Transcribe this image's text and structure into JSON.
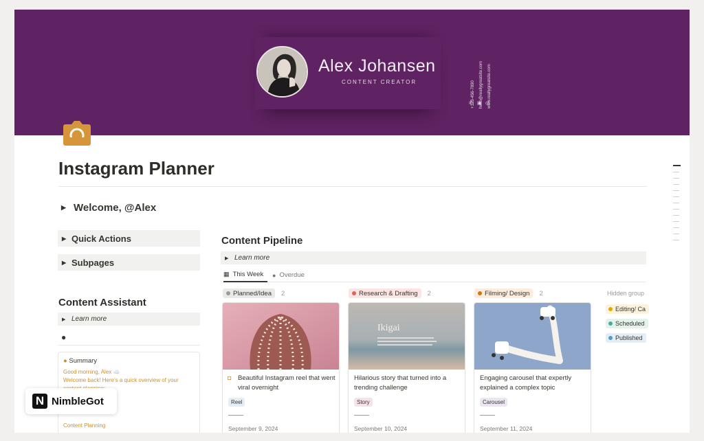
{
  "cover": {
    "name": "Alex Johansen",
    "role": "CONTENT CREATOR",
    "phone": "+123-456-7890",
    "email": "hello@reallygreatsite.com",
    "website": "www.reallygreatsite.com",
    "background_color": "#5f2262"
  },
  "page": {
    "title": "Instagram Planner",
    "welcome_label": "Welcome, @Alex"
  },
  "sidebar": {
    "quick_actions_label": "Quick Actions",
    "subpages_label": "Subpages",
    "assistant_heading": "Content Assistant",
    "learn_more_label": "Learn more",
    "summary": {
      "title": "Summary",
      "line1": "Good morning, Alex ☁️",
      "line2": "Welcome back! Here's a quick overview of your",
      "line3": "content planning:",
      "bottom_label": "Content Planning"
    }
  },
  "badge": {
    "letter": "N",
    "label": "NimbleGot"
  },
  "pipeline": {
    "heading": "Content Pipeline",
    "learn_more_label": "Learn more",
    "tabs": [
      {
        "label": "This Week",
        "active": true
      },
      {
        "label": "Overdue",
        "active": false
      }
    ],
    "groups": [
      {
        "label": "Planned/Idea",
        "count": "2",
        "pill_bg": "#e9e9e7",
        "dot": "#9b9a97",
        "card": {
          "title": "Beautiful Instagram reel that went viral overnight",
          "tag": "Reel",
          "tag_bg": "#e3eef7",
          "date": "September 9, 2024"
        }
      },
      {
        "label": "Research & Drafting",
        "count": "2",
        "pill_bg": "#fbe4e4",
        "dot": "#e16259",
        "card": {
          "title": "Hilarious story that turned into a trending challenge",
          "tag": "Story",
          "tag_bg": "#f6e3ea",
          "date": "September 10, 2024",
          "image_text": "Ikigai"
        }
      },
      {
        "label": "Filming/ Design",
        "count": "2",
        "pill_bg": "#fbecdd",
        "dot": "#d9730d",
        "card": {
          "title": "Engaging carousel that expertly explained a complex topic",
          "tag": "Carousel",
          "tag_bg": "#ece6f3",
          "date": "September 11, 2024"
        }
      }
    ],
    "hidden_groups_label": "Hidden group",
    "hidden_groups": [
      {
        "label": "Editing/ Ca",
        "bg": "#fbf3db",
        "dot": "#dfab01"
      },
      {
        "label": "Scheduled",
        "bg": "#e4f2ea",
        "dot": "#4dab9a"
      },
      {
        "label": "Published",
        "bg": "#e3eef7",
        "dot": "#529cca"
      }
    ]
  },
  "colors": {
    "accent_orange": "#cb912f",
    "page_icon": "#d6953a"
  }
}
